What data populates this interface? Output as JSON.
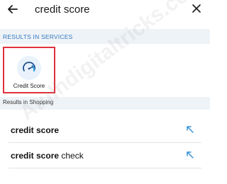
{
  "search": {
    "query": "credit score"
  },
  "services_section": {
    "header": "RESULTS IN SERVICES",
    "items": [
      {
        "label": "Credit Score",
        "icon": "speedometer-icon"
      }
    ]
  },
  "shopping_section": {
    "header": "Results in Shopping",
    "suggestions": [
      {
        "bold": "credit score",
        "rest": ""
      },
      {
        "bold": "credit score",
        "rest": " check"
      }
    ]
  },
  "watermark": "Atulhdigitaltricks.com",
  "colors": {
    "accent_blue": "#3479c0",
    "highlight_red": "#e0313c",
    "section_bg": "#eef3f7"
  }
}
